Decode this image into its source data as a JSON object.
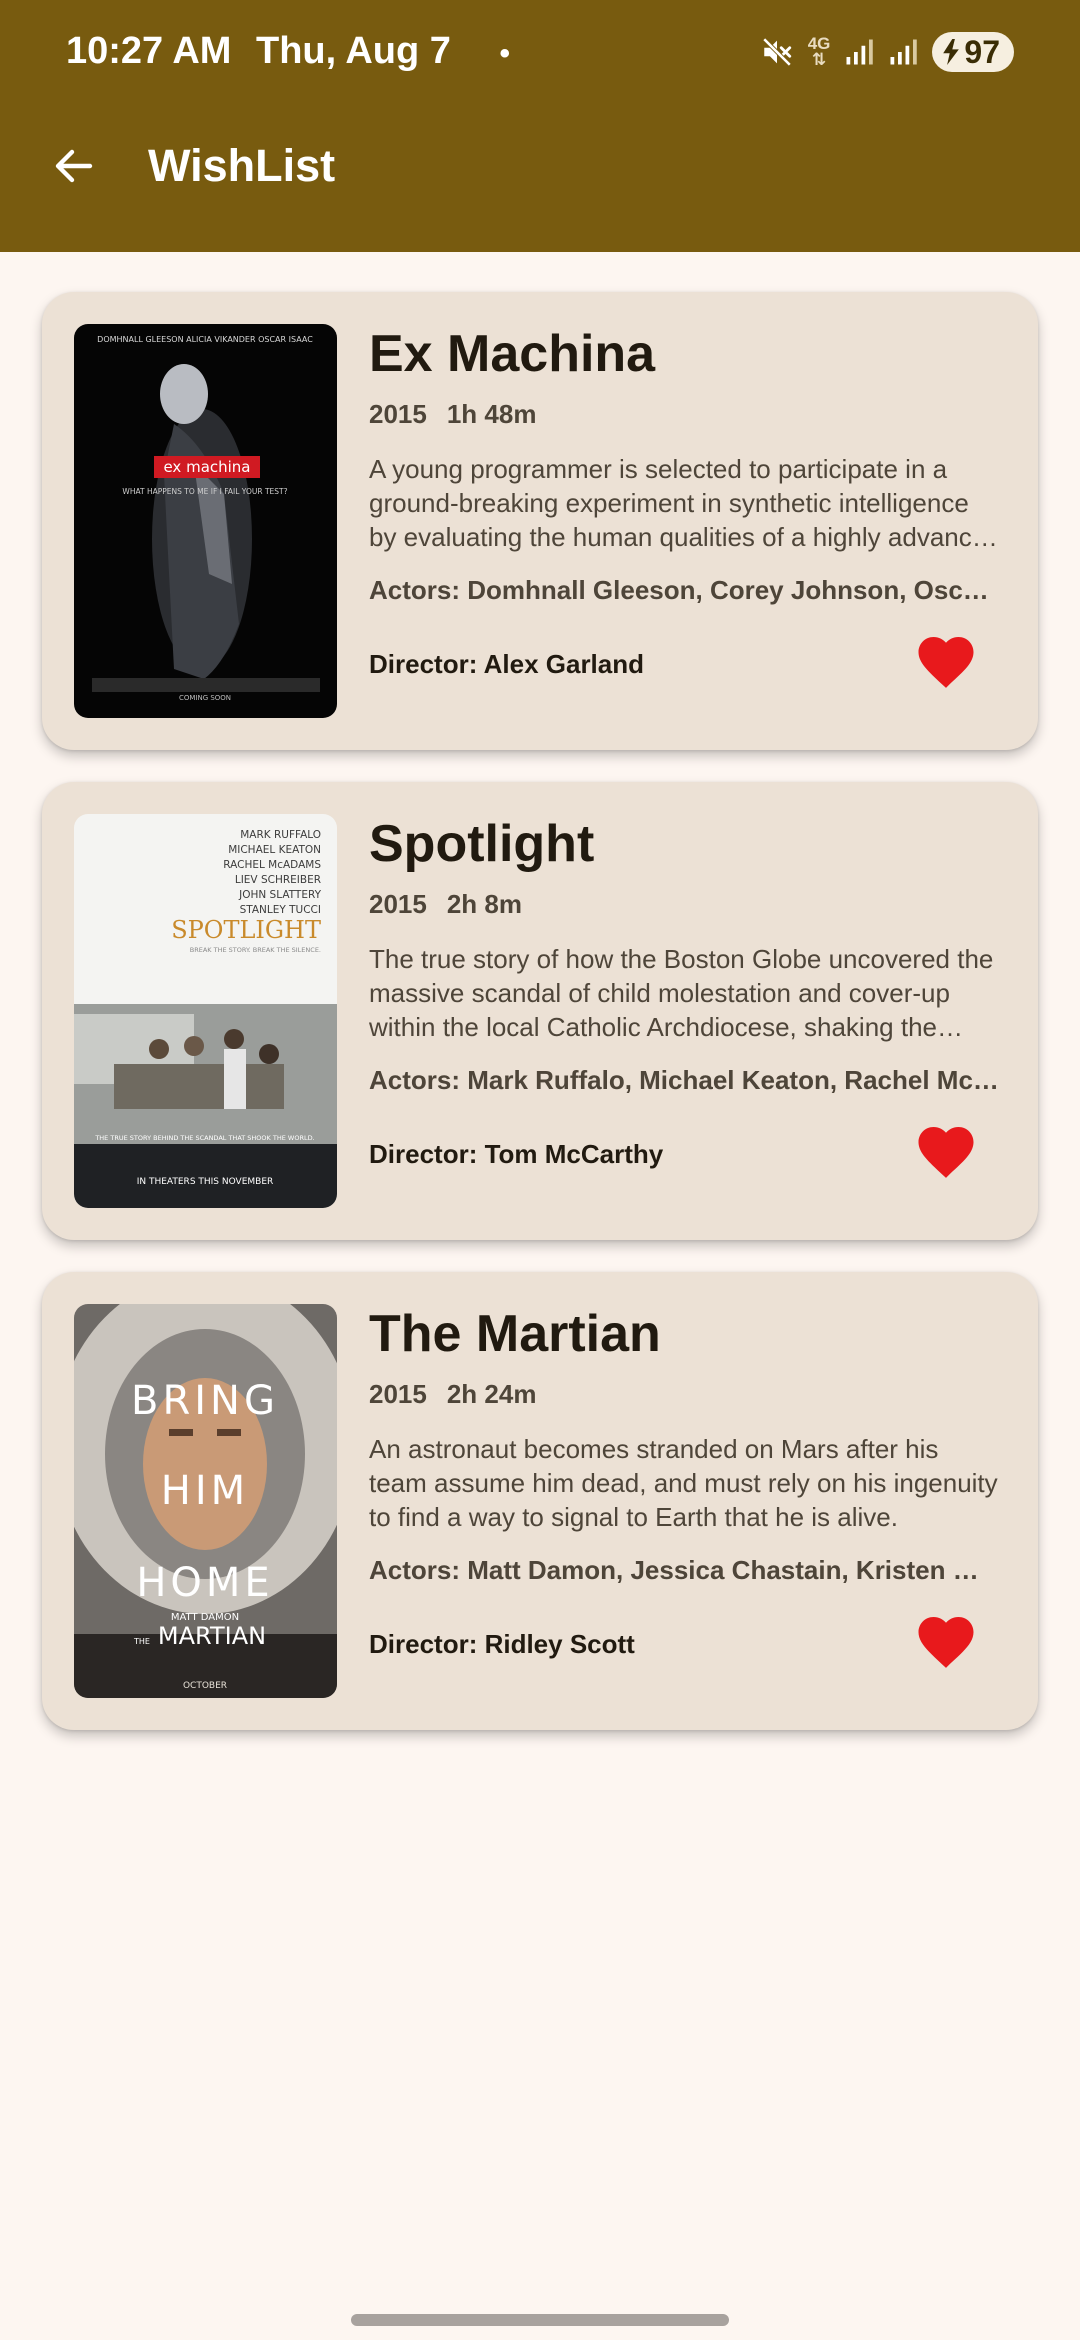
{
  "status_bar": {
    "time": "10:27 AM",
    "date": "Thu, Aug 7",
    "dot": "•",
    "network": "4G",
    "battery": "97"
  },
  "app_bar": {
    "title": "WishList"
  },
  "colors": {
    "app_bar": "#785b0f",
    "card": "#ece1d5",
    "heart": "#e8191c",
    "background": "#fdf6f1"
  },
  "movies": [
    {
      "title": "Ex Machina",
      "year": "2015",
      "runtime": "1h 48m",
      "description": "A young programmer is selected to participate in a ground-breaking experiment in synthetic intelligence by evaluating the human qualities of a highly advanced humanoid A.I.",
      "actors": "Actors: Domhnall Gleeson, Corey Johnson, Oscar Isaac, Alicia Vikander",
      "director": "Director: Alex Garland",
      "poster": {
        "top_names": "DOMHNALL GLEESON   ALICIA VIKANDER   OSCAR ISAAC",
        "logo": "ex machina",
        "tagline": "WHAT HAPPENS TO ME IF I FAIL YOUR TEST?",
        "footer": "COMING SOON"
      }
    },
    {
      "title": "Spotlight",
      "year": "2015",
      "runtime": "2h 8m",
      "description": "The true story of how the Boston Globe uncovered the massive scandal of child molestation and cover-up within the local Catholic Archdiocese, shaking the entire Catholic Church to its core.",
      "actors": "Actors: Mark Ruffalo, Michael Keaton, Rachel McAdams, Liev Schreiber",
      "director": "Director: Tom McCarthy",
      "poster": {
        "cast": [
          "MARK RUFFALO",
          "MICHAEL KEATON",
          "RACHEL McADAMS",
          "LIEV SCHREIBER",
          "JOHN SLATTERY",
          "STANLEY TUCCI"
        ],
        "logo": "SPOTLIGHT",
        "tagline": "BREAK THE STORY. BREAK THE SILENCE.",
        "band": "THE TRUE STORY BEHIND THE SCANDAL THAT SHOOK THE WORLD.",
        "footer": "IN THEATERS THIS NOVEMBER"
      }
    },
    {
      "title": "The Martian",
      "year": "2015",
      "runtime": "2h 24m",
      "description": "An astronaut becomes stranded on Mars after his team assume him dead, and must rely on his ingenuity to find a way to signal to Earth that he is alive.",
      "actors": "Actors: Matt Damon, Jessica Chastain, Kristen Wiig, Jeff Daniels",
      "director": "Director: Ridley Scott",
      "poster": {
        "line1": "BRING",
        "line2": "HIM",
        "line3": "HOME",
        "actor": "MATT DAMON",
        "logo": "MARTIAN",
        "logo_prefix": "THE",
        "footer": "OCTOBER"
      }
    }
  ]
}
